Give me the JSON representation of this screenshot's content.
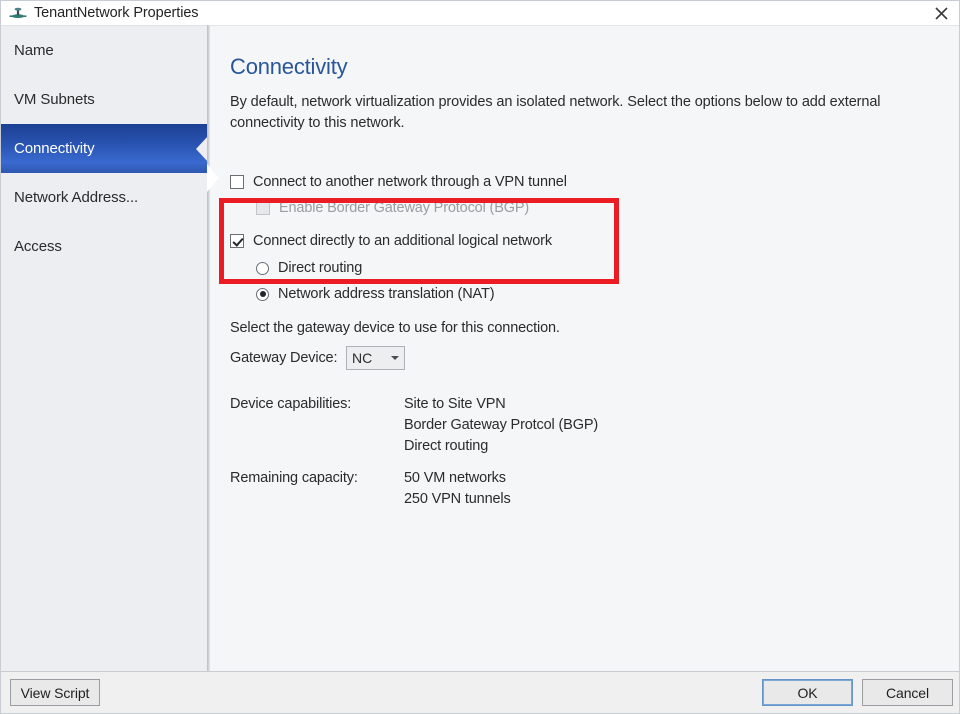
{
  "window": {
    "title": "TenantNetwork Properties",
    "icon": "network-tenant-icon",
    "close_label": "✕"
  },
  "sidebar": {
    "items": [
      {
        "label": "Name",
        "selected": false
      },
      {
        "label": "VM Subnets",
        "selected": false
      },
      {
        "label": "Connectivity",
        "selected": true
      },
      {
        "label": "Network Address...",
        "selected": false
      },
      {
        "label": "Access",
        "selected": false
      }
    ]
  },
  "main": {
    "title": "Connectivity",
    "description": "By default, network virtualization provides an isolated network. Select the options below to add external connectivity to this network.",
    "options": {
      "vpn_tunnel": {
        "label": "Connect to another network through a VPN tunnel",
        "checked": false,
        "enabled": true
      },
      "bgp": {
        "label": "Enable Border Gateway Protocol (BGP)",
        "checked": false,
        "enabled": false
      },
      "direct_logical": {
        "label": "Connect directly to an additional logical network",
        "checked": true,
        "enabled": true
      },
      "direct_routing": {
        "label": "Direct routing",
        "selected": false
      },
      "nat": {
        "label": "Network address translation (NAT)",
        "selected": true
      }
    },
    "gateway": {
      "instruction": "Select the gateway device to use for this connection.",
      "label": "Gateway Device:",
      "value": "NC",
      "options": [
        "NC"
      ]
    },
    "details": [
      {
        "key": "Device capabilities:",
        "values": [
          "Site to Site VPN",
          "Border Gateway Protcol (BGP)",
          "Direct routing"
        ]
      },
      {
        "key": "Remaining capacity:",
        "values": [
          "50 VM networks",
          "250 VPN tunnels"
        ]
      }
    ],
    "annotation": {
      "color": "#ec1c24",
      "note": "highlight rectangle around the direct logical network options"
    }
  },
  "footer": {
    "view_script_label": "View Script",
    "ok_label": "OK",
    "cancel_label": "Cancel"
  },
  "colors": {
    "accent": "#2a5699",
    "selected_nav": "#2a55b4",
    "annotation": "#ec1c24"
  }
}
